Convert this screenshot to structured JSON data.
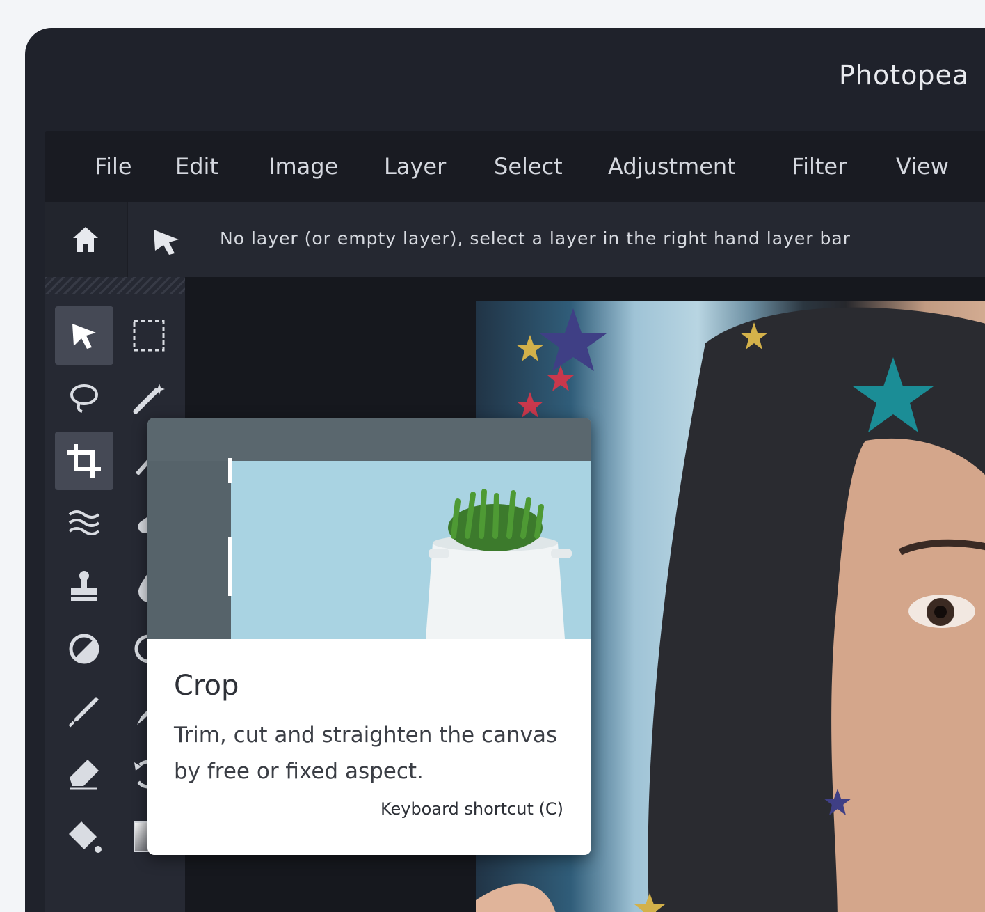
{
  "window": {
    "title": "Photopea"
  },
  "menubar": {
    "items": [
      {
        "label": "File"
      },
      {
        "label": "Edit"
      },
      {
        "label": "Image"
      },
      {
        "label": "Layer"
      },
      {
        "label": "Select"
      },
      {
        "label": "Adjustment"
      },
      {
        "label": "Filter"
      },
      {
        "label": "View"
      }
    ]
  },
  "options_bar": {
    "status": "No layer (or empty layer), select a layer in the right hand layer bar"
  },
  "toolbox": {
    "tools": [
      {
        "icon": "move-tool-icon",
        "active": true
      },
      {
        "icon": "marquee-select-icon",
        "active": false
      },
      {
        "icon": "lasso-icon",
        "active": false
      },
      {
        "icon": "magic-wand-icon",
        "active": false
      },
      {
        "icon": "crop-icon",
        "active": true
      },
      {
        "icon": "slice-icon",
        "active": false
      },
      {
        "icon": "content-aware-icon",
        "active": false
      },
      {
        "icon": "healing-icon",
        "active": false
      },
      {
        "icon": "stamp-icon",
        "active": false
      },
      {
        "icon": "blur-icon",
        "active": false
      },
      {
        "icon": "dodge-icon",
        "active": false
      },
      {
        "icon": "sharpen-icon",
        "active": false
      },
      {
        "icon": "brush-icon",
        "active": false
      },
      {
        "icon": "smudge-icon",
        "active": false
      },
      {
        "icon": "eraser-icon",
        "active": false
      },
      {
        "icon": "recovery-icon",
        "active": false
      },
      {
        "icon": "paint-bucket-icon",
        "active": false
      },
      {
        "icon": "gradient-icon",
        "active": false
      }
    ]
  },
  "tooltip": {
    "title": "Crop",
    "description": "Trim, cut and straighten the canvas by free or fixed aspect.",
    "shortcut": "Keyboard shortcut (C)"
  },
  "colors": {
    "window_bg": "#1f222b",
    "menubar_bg": "#191b22",
    "toolbox_bg": "#262933",
    "workspace_bg": "#16181e",
    "active_tool_bg": "#454955"
  }
}
